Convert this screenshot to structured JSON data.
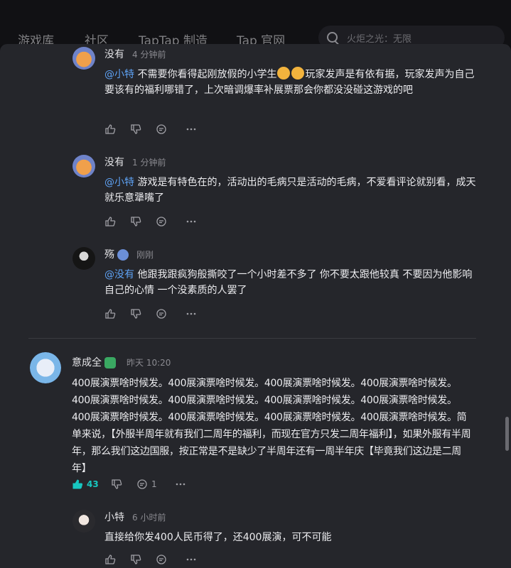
{
  "nav": {
    "items": [
      "游戏库",
      "社区",
      "TapTap 制造",
      "Tap 官网"
    ],
    "search_placeholder": "火炬之光：无限"
  },
  "comments": [
    {
      "user": "没有",
      "time": "4 分钟前",
      "mention": "@小特",
      "text_a": " 不需要你看得起刚放假的小学生",
      "text_b": "玩家发声是有依有据，玩家发声为自己要该有的福利哪错了，上次暗调爆率补展票那会你都没没碰这游戏的吧"
    },
    {
      "user": "没有",
      "time": "1 分钟前",
      "mention": "@小特",
      "text": " 游戏是有特色在的，活动出的毛病只是活动的毛病，不爱看评论就别看，成天就乐意犟嘴了"
    },
    {
      "user": "殇",
      "time": "刚刚",
      "mention": "@没有",
      "text": " 他跟我跟疯狗般撕咬了一个小时差不多了 你不要太跟他较真 不要因为他影响自己的心情 一个没素质的人罢了"
    }
  ],
  "main_comment": {
    "user": "意成全",
    "time": "昨天 10:20",
    "text": "400展演票啥时候发。400展演票啥时候发。400展演票啥时候发。400展演票啥时候发。400展演票啥时候发。400展演票啥时候发。400展演票啥时候发。400展演票啥时候发。400展演票啥时候发。400展演票啥时候发。400展演票啥时候发。400展演票啥时候发。简单来说，【外服半周年就有我们二周年的福利，而现在官方只发二周年福利】，如果外服有半周年，那么我们这边国服，按正常是不是缺少了半周年还有一周半年庆【毕竟我们这边是二周年】",
    "likes": "43",
    "replies": "1"
  },
  "reply": {
    "user": "小特",
    "time": "6 小时前",
    "text": "直接给你发400人民币得了，还400展演，可不可能"
  },
  "colors": {
    "accent": "#17c7c0",
    "mention": "#5ea2f4"
  }
}
